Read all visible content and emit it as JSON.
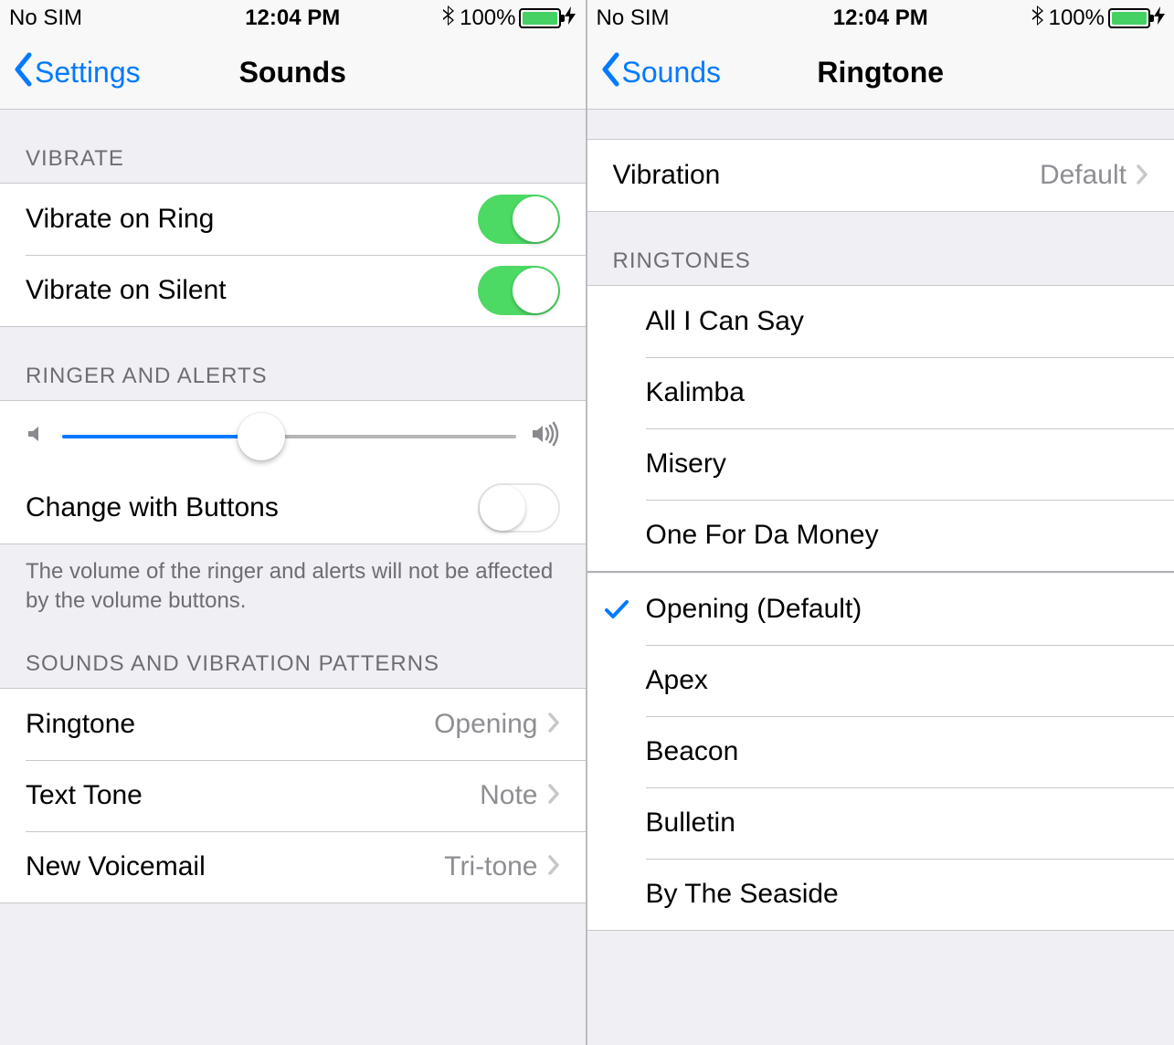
{
  "statusBar": {
    "carrier": "No SIM",
    "time": "12:04 PM",
    "batteryPercent": "100%"
  },
  "left": {
    "back": "Settings",
    "title": "Sounds",
    "sections": {
      "vibrate": {
        "header": "VIBRATE",
        "rows": [
          {
            "key": "vibrate-on-ring",
            "label": "Vibrate on Ring",
            "on": true
          },
          {
            "key": "vibrate-on-silent",
            "label": "Vibrate on Silent",
            "on": true
          }
        ]
      },
      "ringerAlerts": {
        "header": "RINGER AND ALERTS",
        "sliderPercent": 44,
        "changeWithButtons": {
          "label": "Change with Buttons",
          "on": false
        },
        "footer": "The volume of the ringer and alerts will not be affected by the volume buttons."
      },
      "soundsPatterns": {
        "header": "SOUNDS AND VIBRATION PATTERNS",
        "rows": [
          {
            "key": "ringtone",
            "label": "Ringtone",
            "value": "Opening"
          },
          {
            "key": "text-tone",
            "label": "Text Tone",
            "value": "Note"
          },
          {
            "key": "new-voicemail",
            "label": "New Voicemail",
            "value": "Tri-tone"
          }
        ]
      }
    }
  },
  "right": {
    "back": "Sounds",
    "title": "Ringtone",
    "vibration": {
      "label": "Vibration",
      "value": "Default"
    },
    "ringtonesHeader": "RINGTONES",
    "customRingtones": [
      "All I Can Say",
      "Kalimba",
      "Misery",
      "One For Da Money"
    ],
    "builtinRingtones": [
      {
        "label": "Opening (Default)",
        "selected": true
      },
      {
        "label": "Apex",
        "selected": false
      },
      {
        "label": "Beacon",
        "selected": false
      },
      {
        "label": "Bulletin",
        "selected": false
      },
      {
        "label": "By The Seaside",
        "selected": false
      }
    ]
  }
}
